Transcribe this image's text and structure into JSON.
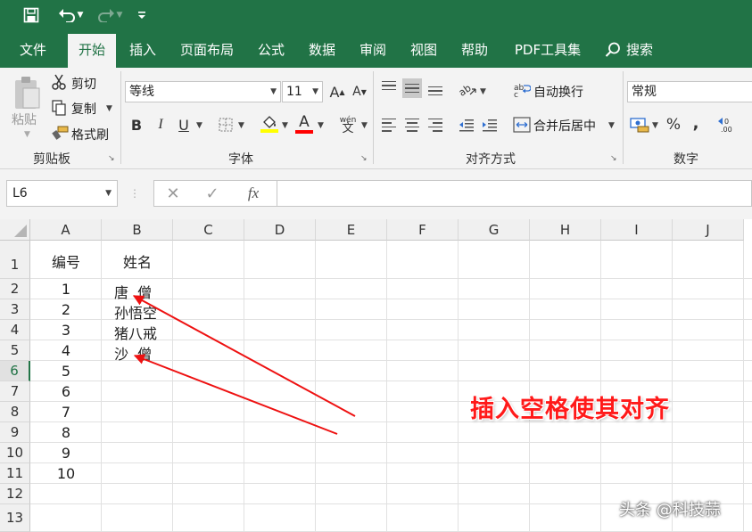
{
  "quick_access": {
    "save_icon": "save-icon",
    "undo_icon": "undo-icon",
    "redo_icon": "redo-icon",
    "customize_icon": "customize-qat-icon"
  },
  "tabs": [
    {
      "label": "文件",
      "active": false
    },
    {
      "label": "开始",
      "active": true
    },
    {
      "label": "插入",
      "active": false
    },
    {
      "label": "页面布局",
      "active": false
    },
    {
      "label": "公式",
      "active": false
    },
    {
      "label": "数据",
      "active": false
    },
    {
      "label": "审阅",
      "active": false
    },
    {
      "label": "视图",
      "active": false
    },
    {
      "label": "帮助",
      "active": false
    },
    {
      "label": "PDF工具集",
      "active": false
    }
  ],
  "search": {
    "label": "搜索",
    "icon": "lightbulb-icon"
  },
  "clipboard": {
    "paste_label": "粘贴",
    "cut_label": "剪切",
    "copy_label": "复制",
    "format_painter_label": "格式刷",
    "group_label": "剪贴板"
  },
  "font": {
    "font_name": "等线",
    "font_size": "11",
    "grow_icon": "A",
    "shrink_icon": "A",
    "bold": "B",
    "italic": "I",
    "underline": "U",
    "font_color_letter": "A",
    "phonetic_label": "wén",
    "group_label": "字体",
    "fill_color": "#ffff00",
    "font_color": "#ff0000"
  },
  "alignment": {
    "wrap_text_label": "自动换行",
    "merge_center_label": "合并后居中",
    "group_label": "对齐方式"
  },
  "number": {
    "format": "常规",
    "percent": "%",
    "comma": ",",
    "group_label": "数字"
  },
  "formula_bar": {
    "name_box": "L6",
    "fx_label": "fx",
    "content": ""
  },
  "sheet": {
    "columns": [
      "A",
      "B",
      "C",
      "D",
      "E",
      "F",
      "G",
      "H",
      "I",
      "J"
    ],
    "rows": [
      "1",
      "2",
      "3",
      "4",
      "5",
      "6",
      "7",
      "8",
      "9",
      "10",
      "11",
      "12",
      "13"
    ],
    "selected_row": "6",
    "header": {
      "a": "编号",
      "b": "姓名"
    },
    "data": [
      {
        "a": "1",
        "b": "唐  僧"
      },
      {
        "a": "2",
        "b": "孙悟空"
      },
      {
        "a": "3",
        "b": "猪八戒"
      },
      {
        "a": "4",
        "b": "沙  僧"
      },
      {
        "a": "5",
        "b": ""
      },
      {
        "a": "6",
        "b": ""
      },
      {
        "a": "7",
        "b": ""
      },
      {
        "a": "8",
        "b": ""
      },
      {
        "a": "9",
        "b": ""
      },
      {
        "a": "10",
        "b": ""
      }
    ]
  },
  "annotation": {
    "text": "插入空格使其对齐",
    "color": "#ff1a1a"
  },
  "watermark": "头条 @科技蒜",
  "colors": {
    "brand_green": "#217346",
    "ribbon_bg": "#f3f3f3"
  }
}
